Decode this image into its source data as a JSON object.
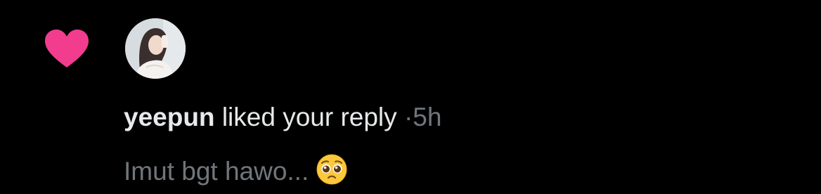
{
  "notification": {
    "type_icon": "heart-icon",
    "type_color": "#f91880",
    "avatar": "user-avatar-photo",
    "username": "yeepun",
    "action_text": "liked your reply",
    "separator": "·",
    "time": "5h",
    "reply_text": "Imut bgt hawo...",
    "reply_emoji": "pleading-face-emoji"
  },
  "colors": {
    "background": "#000000",
    "primary_text": "#e7e9ea",
    "secondary_text": "#71767b",
    "like_pink": "#f91880"
  }
}
